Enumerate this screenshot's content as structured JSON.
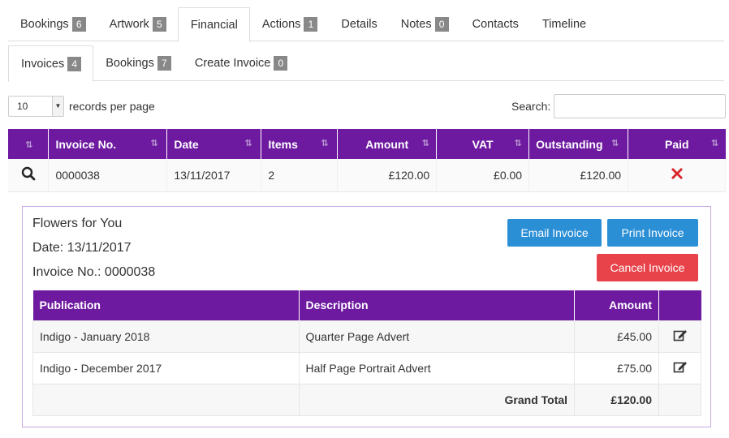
{
  "tabs_top": [
    {
      "label": "Bookings",
      "count": "6"
    },
    {
      "label": "Artwork",
      "count": "5"
    },
    {
      "label": "Financial",
      "count": null,
      "active": true
    },
    {
      "label": "Actions",
      "count": "1"
    },
    {
      "label": "Details",
      "count": null
    },
    {
      "label": "Notes",
      "count": "0"
    },
    {
      "label": "Contacts",
      "count": null
    },
    {
      "label": "Timeline",
      "count": null
    }
  ],
  "tabs_sub": [
    {
      "label": "Invoices",
      "count": "4",
      "active": true
    },
    {
      "label": "Bookings",
      "count": "7"
    },
    {
      "label": "Create Invoice",
      "count": "0"
    }
  ],
  "records": {
    "value": "10",
    "label": "records per page"
  },
  "search": {
    "label": "Search:",
    "value": ""
  },
  "main_table": {
    "headers": [
      "",
      "Invoice No.",
      "Date",
      "Items",
      "Amount",
      "VAT",
      "Outstanding",
      "Paid"
    ],
    "rows": [
      {
        "invoice_no": "0000038",
        "date": "13/11/2017",
        "items": "2",
        "amount": "£120.00",
        "vat": "£0.00",
        "outstanding": "£120.00",
        "paid": false
      }
    ]
  },
  "detail": {
    "client": "Flowers for You",
    "date_line": "Date: 13/11/2017",
    "invoice_line": "Invoice No.: 0000038",
    "buttons": {
      "email": "Email Invoice",
      "print": "Print Invoice",
      "cancel": "Cancel Invoice"
    },
    "table": {
      "headers": [
        "Publication",
        "Description",
        "Amount",
        ""
      ],
      "rows": [
        {
          "publication": "Indigo - January 2018",
          "description": "Quarter Page Advert",
          "amount": "£45.00"
        },
        {
          "publication": "Indigo - December 2017",
          "description": "Half Page Portrait Advert",
          "amount": "£75.00"
        }
      ],
      "total_label": "Grand Total",
      "total_value": "£120.00"
    }
  },
  "colors": {
    "header_purple": "#6e1aa0",
    "blue": "#2b8fd6",
    "red": "#e8434a",
    "cross_red": "#d8232a"
  }
}
